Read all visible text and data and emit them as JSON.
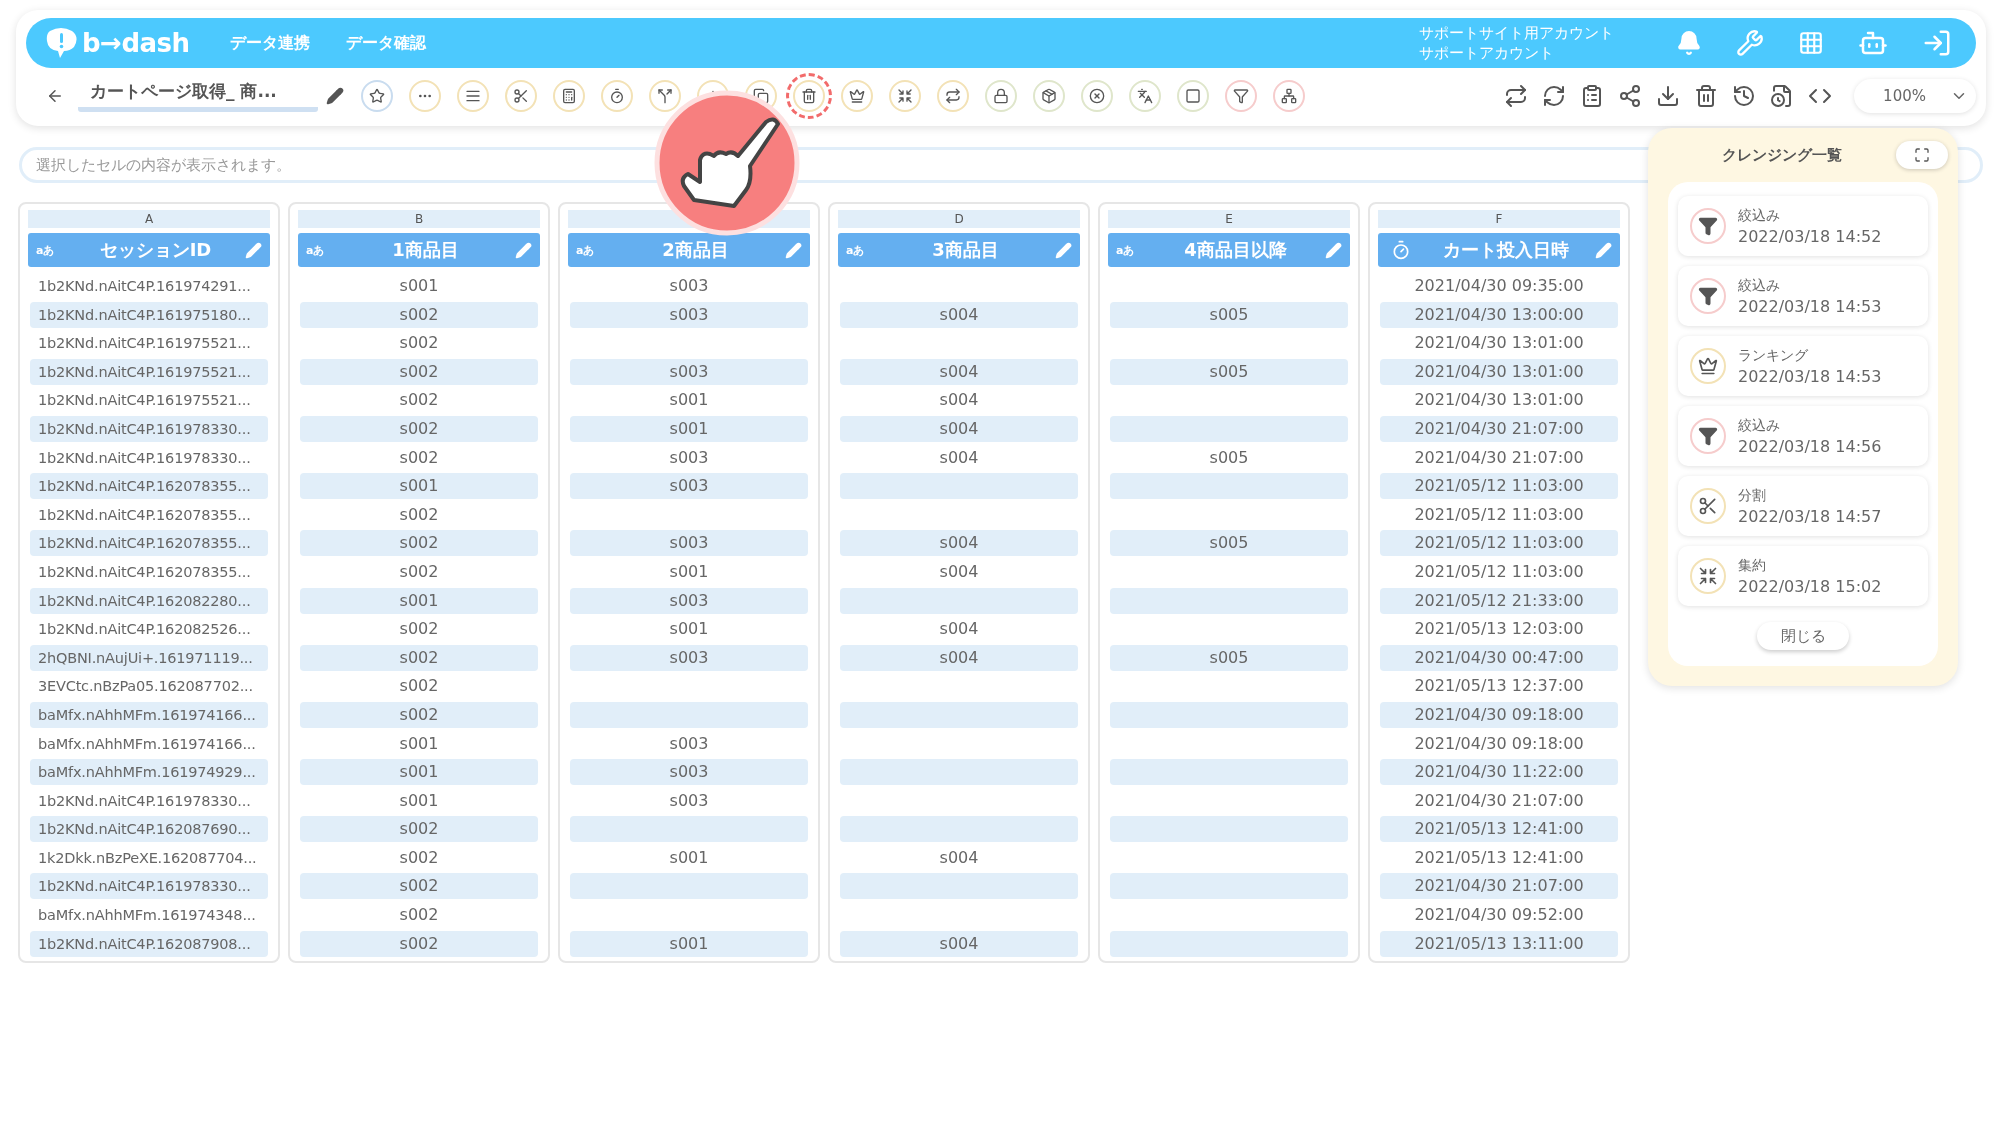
{
  "header": {
    "logo": "b→dash",
    "nav": [
      {
        "label": "データ連携"
      },
      {
        "label": "データ確認"
      }
    ],
    "account": {
      "line_1": "サポートサイト用アカウント",
      "line_2": "サポートアカウント"
    }
  },
  "toolbar": {
    "title": "カートページ取得_ 商...",
    "tools": [
      {
        "color": "#c9dcef",
        "highlighted": false
      },
      {
        "color": "#f3e2b6",
        "highlighted": false
      },
      {
        "color": "#f3e2b6",
        "highlighted": false
      },
      {
        "color": "#f3e2b6",
        "highlighted": false
      },
      {
        "color": "#f3e2b6",
        "highlighted": false
      },
      {
        "color": "#f3e2b6",
        "highlighted": false
      },
      {
        "color": "#f3e2b6",
        "highlighted": false
      },
      {
        "color": "#f3e2b6",
        "highlighted": false
      },
      {
        "color": "#f3e2b6",
        "highlighted": false
      },
      {
        "color": "#f3e2b6",
        "highlighted": true
      },
      {
        "color": "#f3e2b6",
        "highlighted": false
      },
      {
        "color": "#f3e2b6",
        "highlighted": false
      },
      {
        "color": "#f3e2b6",
        "highlighted": false
      },
      {
        "color": "#dfe6cb",
        "highlighted": false
      },
      {
        "color": "#dfe6cb",
        "highlighted": false
      },
      {
        "color": "#dfe6cb",
        "highlighted": false
      },
      {
        "color": "#dfe6cb",
        "highlighted": false
      },
      {
        "color": "#dfe6cb",
        "highlighted": false
      },
      {
        "color": "#f6cccc",
        "highlighted": false
      },
      {
        "color": "#f6cccc",
        "highlighted": false
      }
    ],
    "zoom": "100%"
  },
  "cell_field": {
    "placeholder": "選択したセルの内容が表示されます。"
  },
  "table": {
    "columns": [
      {
        "letter": "A",
        "kind": "text",
        "type_label": "aあ",
        "title": "セッションID"
      },
      {
        "letter": "B",
        "kind": "text",
        "type_label": "aあ",
        "title": "1商品目"
      },
      {
        "kind": "text",
        "type_label": "aあ",
        "title": "2商品目"
      },
      {
        "letter": "D",
        "kind": "text",
        "type_label": "aあ",
        "title": "3商品目"
      },
      {
        "letter": "E",
        "kind": "text",
        "type_label": "aあ",
        "title": "4商品目以降"
      },
      {
        "letter": "F",
        "kind": "datetime",
        "title": "カート投入日時"
      }
    ],
    "rows": [
      {
        "a": "1b2KNd.nAitC4P.161974291...",
        "b": "s001",
        "c": "s003",
        "f": "2021/04/30 09:35:00"
      },
      {
        "a": "1b2KNd.nAitC4P.161975180...",
        "b": "s002",
        "c": "s003",
        "d": "s004",
        "e": "s005",
        "f": "2021/04/30 13:00:00"
      },
      {
        "a": "1b2KNd.nAitC4P.161975521...",
        "b": "s002",
        "f": "2021/04/30 13:01:00"
      },
      {
        "a": "1b2KNd.nAitC4P.161975521...",
        "b": "s002",
        "c": "s003",
        "d": "s004",
        "e": "s005",
        "f": "2021/04/30 13:01:00"
      },
      {
        "a": "1b2KNd.nAitC4P.161975521...",
        "b": "s002",
        "c": "s001",
        "d": "s004",
        "f": "2021/04/30 13:01:00"
      },
      {
        "a": "1b2KNd.nAitC4P.161978330...",
        "b": "s002",
        "c": "s001",
        "d": "s004",
        "f": "2021/04/30 21:07:00"
      },
      {
        "a": "1b2KNd.nAitC4P.161978330...",
        "b": "s002",
        "c": "s003",
        "d": "s004",
        "e": "s005",
        "f": "2021/04/30 21:07:00"
      },
      {
        "a": "1b2KNd.nAitC4P.162078355...",
        "b": "s001",
        "c": "s003",
        "f": "2021/05/12 11:03:00"
      },
      {
        "a": "1b2KNd.nAitC4P.162078355...",
        "b": "s002",
        "f": "2021/05/12 11:03:00"
      },
      {
        "a": "1b2KNd.nAitC4P.162078355...",
        "b": "s002",
        "c": "s003",
        "d": "s004",
        "e": "s005",
        "f": "2021/05/12 11:03:00"
      },
      {
        "a": "1b2KNd.nAitC4P.162078355...",
        "b": "s002",
        "c": "s001",
        "d": "s004",
        "f": "2021/05/12 11:03:00"
      },
      {
        "a": "1b2KNd.nAitC4P.162082280...",
        "b": "s001",
        "c": "s003",
        "f": "2021/05/12 21:33:00"
      },
      {
        "a": "1b2KNd.nAitC4P.162082526...",
        "b": "s002",
        "c": "s001",
        "d": "s004",
        "f": "2021/05/13 12:03:00"
      },
      {
        "a": "2hQBNI.nAujUi+.161971119...",
        "b": "s002",
        "c": "s003",
        "d": "s004",
        "e": "s005",
        "f": "2021/04/30 00:47:00"
      },
      {
        "a": "3EVCtc.nBzPa05.162087702...",
        "b": "s002",
        "f": "2021/05/13 12:37:00"
      },
      {
        "a": "baMfx.nAhhMFm.161974166...",
        "b": "s002",
        "f": "2021/04/30 09:18:00"
      },
      {
        "a": "baMfx.nAhhMFm.161974166...",
        "b": "s001",
        "c": "s003",
        "f": "2021/04/30 09:18:00"
      },
      {
        "a": "baMfx.nAhhMFm.161974929...",
        "b": "s001",
        "c": "s003",
        "f": "2021/04/30 11:22:00"
      },
      {
        "a": "1b2KNd.nAitC4P.161978330...",
        "b": "s001",
        "c": "s003",
        "f": "2021/04/30 21:07:00"
      },
      {
        "a": "1b2KNd.nAitC4P.162087690...",
        "b": "s002",
        "f": "2021/05/13 12:41:00"
      },
      {
        "a": "1k2Dkk.nBzPeXE.162087704...",
        "b": "s002",
        "c": "s001",
        "d": "s004",
        "f": "2021/05/13 12:41:00"
      },
      {
        "a": "1b2KNd.nAitC4P.161978330...",
        "b": "s002",
        "f": "2021/04/30 21:07:00"
      },
      {
        "a": "baMfx.nAhhMFm.161974348...",
        "b": "s002",
        "f": "2021/04/30 09:52:00"
      },
      {
        "a": "1b2KNd.nAitC4P.162087908...",
        "b": "s002",
        "c": "s001",
        "d": "s004",
        "f": "2021/05/13 13:11:00"
      }
    ]
  },
  "cleansing_panel": {
    "title": "クレンジング一覧",
    "items": [
      {
        "kind": "filter",
        "label": "絞込み",
        "time": "2022/03/18 14:52"
      },
      {
        "kind": "filter",
        "label": "絞込み",
        "time": "2022/03/18 14:53"
      },
      {
        "kind": "ranking",
        "label": "ランキング",
        "time": "2022/03/18 14:53"
      },
      {
        "kind": "filter",
        "label": "絞込み",
        "time": "2022/03/18 14:56"
      },
      {
        "kind": "split",
        "label": "分割",
        "time": "2022/03/18 14:57"
      },
      {
        "kind": "aggregate",
        "label": "集約",
        "time": "2022/03/18 15:02"
      }
    ],
    "close_button": "閉じる"
  }
}
